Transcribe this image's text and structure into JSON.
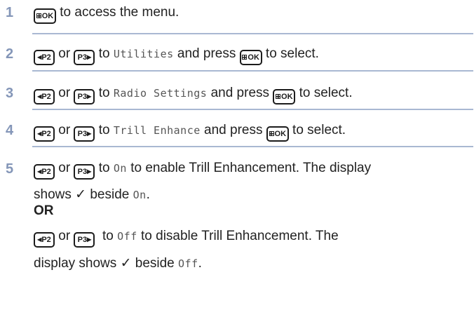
{
  "icons": {
    "menu_ok": "menu-ok-key-icon",
    "p2": "p2-left-key-icon",
    "p3": "p3-right-key-icon",
    "p2_label": "P2",
    "p3_label": "P3",
    "ok_label": "OK"
  },
  "colors": {
    "step_number": "#8496b8",
    "separator": "#a9b8d2",
    "text": "#222222"
  },
  "steps": [
    {
      "number": "1",
      "text_after_key": " to access the menu."
    },
    {
      "number": "2",
      "or": " or ",
      "to": " to ",
      "item": "Utilities",
      "and_press": " and press ",
      "to_select": " to select."
    },
    {
      "number": "3",
      "or": " or ",
      "to": " to ",
      "item": "Radio Settings",
      "and_press": " and press ",
      "to_select": " to select."
    },
    {
      "number": "4",
      "or": " or ",
      "to": " to ",
      "item": "Trill Enhance",
      "and_press": " and press ",
      "to_select": " to select."
    },
    {
      "number": "5",
      "or": " or ",
      "to": " to ",
      "item_on": "On",
      "enable_text": " to enable Trill Enhancement. The display",
      "shows": "shows ",
      "check": "✓",
      "beside": " beside ",
      "period": ".",
      "alt_label": "OR",
      "or2": " or ",
      "to2": "  to ",
      "item_off": "Off",
      "disable_text": " to disable Trill Enhancement. The",
      "display_shows": "display shows ",
      "check2": "✓",
      "beside2": " beside ",
      "period2": "."
    }
  ]
}
